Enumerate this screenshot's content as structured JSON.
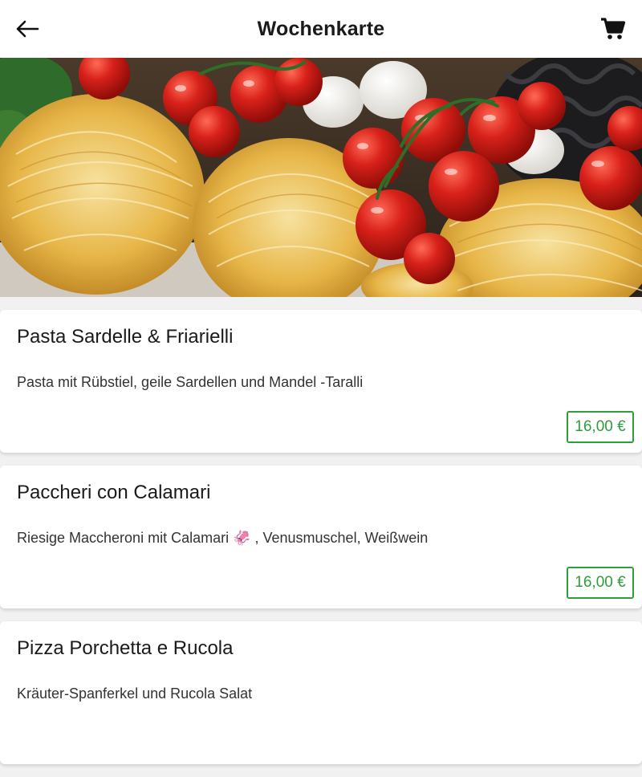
{
  "header": {
    "title": "Wochenkarte",
    "back_icon": "arrow-left-icon",
    "cart_icon": "shopping-cart-icon"
  },
  "hero": {
    "image": "pasta-tomatoes-photo"
  },
  "menu": {
    "items": [
      {
        "title": "Pasta Sardelle & Friarielli",
        "description": "Pasta mit Rübstiel, geile Sardellen und Mandel -Taralli",
        "price": "16,00 €"
      },
      {
        "title": "Paccheri con Calamari",
        "description": "Riesige Maccheroni mit Calamari 🦑 , Venusmuschel, Weißwein",
        "price": "16,00 €"
      },
      {
        "title": "Pizza Porchetta e Rucola",
        "description": "Kräuter-Spanferkel und Rucola Salat",
        "price": ""
      }
    ]
  },
  "colors": {
    "accent": "#2e9e3a",
    "background": "#f1f1f1",
    "card": "#ffffff"
  }
}
